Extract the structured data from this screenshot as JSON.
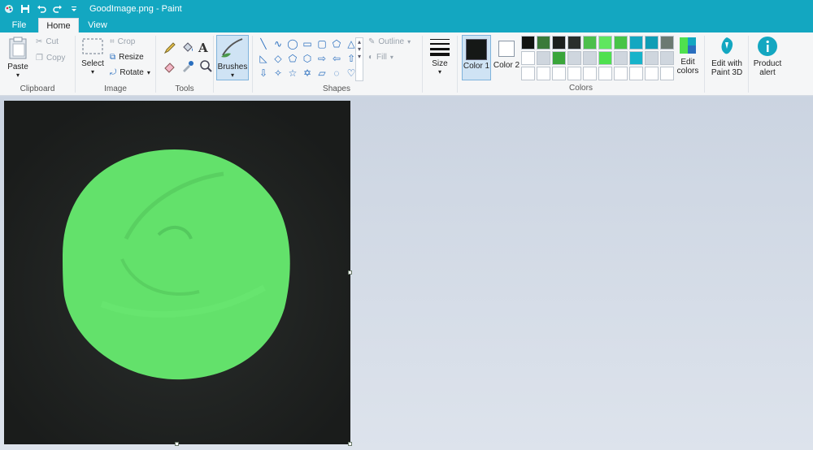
{
  "window": {
    "title": "GoodImage.png - Paint"
  },
  "tabs": {
    "file": "File",
    "home": "Home",
    "view": "View"
  },
  "clipboard": {
    "paste": "Paste",
    "cut": "Cut",
    "copy": "Copy",
    "label": "Clipboard"
  },
  "image": {
    "select": "Select",
    "crop": "Crop",
    "resize": "Resize",
    "rotate": "Rotate",
    "label": "Image"
  },
  "tools": {
    "label": "Tools",
    "text_glyph": "A"
  },
  "brushes": {
    "label": "Brushes"
  },
  "shapes": {
    "outline": "Outline",
    "fill": "Fill",
    "label": "Shapes",
    "items": [
      "line-icon",
      "curve-icon",
      "oval-icon",
      "rectangle-icon",
      "rounded-rectangle-icon",
      "polygon-icon",
      "triangle-icon",
      "right-triangle-icon",
      "diamond-icon",
      "pentagon-icon",
      "hexagon-icon",
      "arrow-right-icon",
      "arrow-left-icon",
      "arrow-up-icon",
      "arrow-down-icon",
      "star4-icon",
      "star5-icon",
      "star6-icon",
      "callout-rect-icon",
      "callout-oval-icon",
      "heart-icon"
    ]
  },
  "size": {
    "label": "Size"
  },
  "colors": {
    "color1": "Color 1",
    "color2": "Color 2",
    "label": "Colors",
    "edit": "Edit colors",
    "color1_value": "#151816",
    "color2_value": "#ffffff",
    "palette": [
      "#111411",
      "#3a7a3a",
      "#1b1f1d",
      "#2a2f2c",
      "#4cbf4c",
      "#5fe65f",
      "#47c447",
      "#13a7c1",
      "#0f9db5",
      "#6b7a72",
      "#ffffff",
      "#cfd6de",
      "#3aa53a",
      "#cfd6de",
      "#cfd6de",
      "#4fe04f",
      "#cfd6de",
      "#17b3ca",
      "#cfd6de",
      "#cfd6de",
      "#ffffff",
      "#ffffff",
      "#ffffff",
      "#ffffff",
      "#ffffff",
      "#ffffff",
      "#ffffff",
      "#ffffff",
      "#ffffff",
      "#ffffff"
    ]
  },
  "extra": {
    "paint3d": "Edit with Paint 3D",
    "alert": "Product alert"
  },
  "canvas": {
    "background": "#232725",
    "ball_color": "#63e16b"
  }
}
